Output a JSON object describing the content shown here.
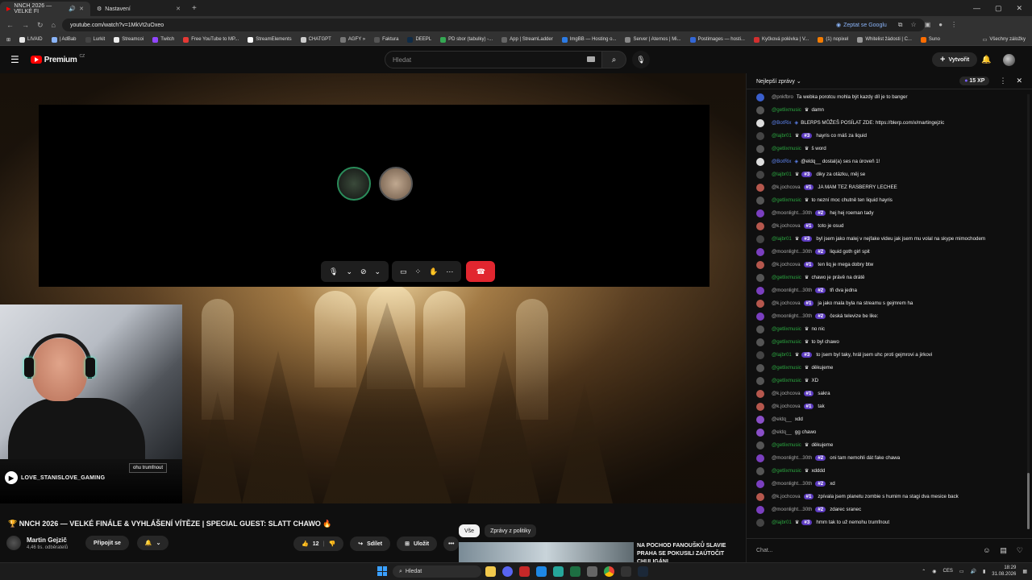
{
  "browser": {
    "tabs": [
      {
        "label": "NNCH 2026 — VELKÉ FI",
        "active": true
      },
      {
        "label": "Nastavení",
        "active": false
      }
    ],
    "url": "youtube.com/watch?v=1MkVt2uOxeo",
    "ask_google": "Zeptat se Googlu",
    "bookmarks": [
      {
        "label": "LIVAID",
        "color": "#e8e8e8"
      },
      {
        "label": "| AdBab",
        "color": "#8ab4f8"
      },
      {
        "label": "Lurkit",
        "color": "#444"
      },
      {
        "label": "Streamcoi",
        "color": "#eee"
      },
      {
        "label": "Twitch",
        "color": "#9146ff"
      },
      {
        "label": "Free YouTube to MP...",
        "color": "#e53935"
      },
      {
        "label": "StreamElements",
        "color": "#fff"
      },
      {
        "label": "CHATGPT",
        "color": "#ccc"
      },
      {
        "label": "AGFY »",
        "color": "#777"
      },
      {
        "label": "Faktura",
        "color": "#555"
      },
      {
        "label": "DEEPL",
        "color": "#0f2b46"
      },
      {
        "label": "PD sbor (tabulky) -...",
        "color": "#34a853"
      },
      {
        "label": "App | StreamLadder",
        "color": "#666"
      },
      {
        "label": "ImgBB — Hosting o...",
        "color": "#2c7be5"
      },
      {
        "label": "Server | Aternos | Mi...",
        "color": "#888"
      },
      {
        "label": "Postimages — hosti...",
        "color": "#3367d6"
      },
      {
        "label": "Kyčková polévka | V...",
        "color": "#d32f2f"
      },
      {
        "label": "(1) nopixel",
        "color": "#f57c00"
      },
      {
        "label": "Whitelist žádosti | C...",
        "color": "#999"
      },
      {
        "label": "Suno",
        "color": "#ff6d00"
      }
    ],
    "bookmarks_all": "Všechny záložky"
  },
  "youtube": {
    "logo_text": "Premium",
    "logo_sup": "CZ",
    "search_placeholder": "Hledat",
    "create_label": "Vytvořit"
  },
  "stream": {
    "streamer_name": "LOVE_STANISLOVE_GAMING",
    "overlay_text": "ohu trumfnout"
  },
  "video": {
    "title": "🏆 NNCH 2026 — VELKÉ FINÁLE & VYHLÁŠENÍ VÍTĚZE | SPECIAL GUEST: SLATT CHAWO 🔥",
    "channel": "Martin Gejzič",
    "subs": "4,46 tis. odběratelů",
    "subscribe": "Připojit se",
    "likes": "12",
    "share": "Sdílet",
    "save": "Uložit",
    "dots": "•••"
  },
  "recommended": {
    "chips": [
      "Vše",
      "Zprávy z politiky"
    ],
    "title": "NA POCHOD FANOUŠKŮ SLAVIE PRAHA SE POKUSILI ZAÚTOČIT CHULIGÁNI"
  },
  "chat": {
    "header": "Nejlepší zprávy",
    "xp": "15 XP",
    "input_placeholder": "Chat...",
    "messages": [
      {
        "author": "@pnkfbro",
        "style": "gray",
        "crown": false,
        "rank": "",
        "text": "Ta webka porotcu mohla být kazdy díl je to banger",
        "av": "#3a5fcd"
      },
      {
        "author": "@getlixmusic",
        "style": "green",
        "crown": true,
        "rank": "",
        "text": "damn",
        "av": "#555"
      },
      {
        "author": "@BotRix",
        "style": "blue",
        "crown": false,
        "rank": "",
        "text": "BLERPS MŮŽEŠ POSÍLAT ZDE: https://blerp.com/x/martingejzic",
        "av": "#ddd"
      },
      {
        "author": "@lajbr01",
        "style": "green",
        "crown": true,
        "rank": "#3",
        "text": "hayris co máš za liquid",
        "av": "#444"
      },
      {
        "author": "@getlixmusic",
        "style": "green",
        "crown": true,
        "rank": "",
        "text": "š word",
        "av": "#555"
      },
      {
        "author": "@BotRix",
        "style": "blue",
        "crown": false,
        "rank": "",
        "text": "@eldq__ dostal(a) ses na úroveň 1!",
        "av": "#ddd"
      },
      {
        "author": "@lajbr01",
        "style": "green",
        "crown": true,
        "rank": "#3",
        "text": "diky za otázku, měj se",
        "av": "#444"
      },
      {
        "author": "@k.jochcova",
        "style": "gray",
        "crown": false,
        "rank": "#1",
        "text": "JA MAM TEZ RASBERRY LECHEE",
        "av": "#b5574d"
      },
      {
        "author": "@getlixmusic",
        "style": "green",
        "crown": true,
        "rank": "",
        "text": "to nezní moc chutně ten liquid hayris",
        "av": "#555"
      },
      {
        "author": "@moonlight...30th",
        "style": "gray",
        "crown": false,
        "rank": "#2",
        "text": "hej hej roeman tady",
        "av": "#7a3fbf"
      },
      {
        "author": "@k.jochcova",
        "style": "gray",
        "crown": false,
        "rank": "#1",
        "text": "toto je osud",
        "av": "#b5574d"
      },
      {
        "author": "@lajbr01",
        "style": "green",
        "crown": true,
        "rank": "#3",
        "text": "byl jsem jako malej v nejfake videu jak jsem mu volal na skype mimochodem",
        "av": "#444"
      },
      {
        "author": "@moonlight...30th",
        "style": "gray",
        "crown": false,
        "rank": "#2",
        "text": "liquid goth girl spit",
        "av": "#7a3fbf"
      },
      {
        "author": "@k.jochcova",
        "style": "gray",
        "crown": false,
        "rank": "#1",
        "text": "ten liq je mega dobry btw",
        "av": "#b5574d"
      },
      {
        "author": "@getlixmusic",
        "style": "green",
        "crown": true,
        "rank": "",
        "text": "chawo je právě na drátě",
        "av": "#555"
      },
      {
        "author": "@moonlight...30th",
        "style": "gray",
        "crown": false,
        "rank": "#2",
        "text": "tři dva jedna",
        "av": "#7a3fbf"
      },
      {
        "author": "@k.jochcova",
        "style": "gray",
        "crown": false,
        "rank": "#1",
        "text": "ja jako mala byla na streamu s gejmrem ha",
        "av": "#b5574d"
      },
      {
        "author": "@moonlight...30th",
        "style": "gray",
        "crown": false,
        "rank": "#2",
        "text": "česká televize be like:",
        "av": "#7a3fbf"
      },
      {
        "author": "@getlixmusic",
        "style": "green",
        "crown": true,
        "rank": "",
        "text": "no nic",
        "av": "#555"
      },
      {
        "author": "@getlixmusic",
        "style": "green",
        "crown": true,
        "rank": "",
        "text": "to byl chawo",
        "av": "#555"
      },
      {
        "author": "@lajbr01",
        "style": "green",
        "crown": true,
        "rank": "#3",
        "text": "to jsem byl taky, hrál jsem uhc proti gejmrovi a jirkovi",
        "av": "#444"
      },
      {
        "author": "@getlixmusic",
        "style": "green",
        "crown": true,
        "rank": "",
        "text": "děkujeme",
        "av": "#555"
      },
      {
        "author": "@getlixmusic",
        "style": "green",
        "crown": true,
        "rank": "",
        "text": "XD",
        "av": "#555"
      },
      {
        "author": "@k.jochcova",
        "style": "gray",
        "crown": false,
        "rank": "#1",
        "text": "sakra",
        "av": "#b5574d"
      },
      {
        "author": "@k.jochcova",
        "style": "gray",
        "crown": false,
        "rank": "#1",
        "text": "tak",
        "av": "#b5574d"
      },
      {
        "author": "@eldq__",
        "style": "gray",
        "crown": false,
        "rank": "",
        "text": "xdd",
        "av": "#8a4fc8"
      },
      {
        "author": "@eldq__",
        "style": "gray",
        "crown": false,
        "rank": "",
        "text": "gg chawo",
        "av": "#8a4fc8"
      },
      {
        "author": "@getlixmusic",
        "style": "green",
        "crown": true,
        "rank": "",
        "text": "děkujeme",
        "av": "#555"
      },
      {
        "author": "@moonlight...30th",
        "style": "gray",
        "crown": false,
        "rank": "#2",
        "text": "oni tam nemohli dát fake chawa",
        "av": "#7a3fbf"
      },
      {
        "author": "@getlixmusic",
        "style": "green",
        "crown": true,
        "rank": "",
        "text": "xdddd",
        "av": "#555"
      },
      {
        "author": "@moonlight...30th",
        "style": "gray",
        "crown": false,
        "rank": "#2",
        "text": "xd",
        "av": "#7a3fbf"
      },
      {
        "author": "@k.jochcova",
        "style": "gray",
        "crown": false,
        "rank": "#1",
        "text": "zpívala jsem planetu zombie s humim na stagi dva mesice back",
        "av": "#b5574d"
      },
      {
        "author": "@moonlight...30th",
        "style": "gray",
        "crown": false,
        "rank": "#2",
        "text": "zdarec sranec",
        "av": "#7a3fbf"
      },
      {
        "author": "@lajbr01",
        "style": "green",
        "crown": true,
        "rank": "#3",
        "text": "hmm tak to už nemohu trumfnout",
        "av": "#444"
      }
    ]
  },
  "taskbar": {
    "search": "Hledat",
    "lang": "CES",
    "time": "18:29",
    "date": "31.08.2026"
  }
}
